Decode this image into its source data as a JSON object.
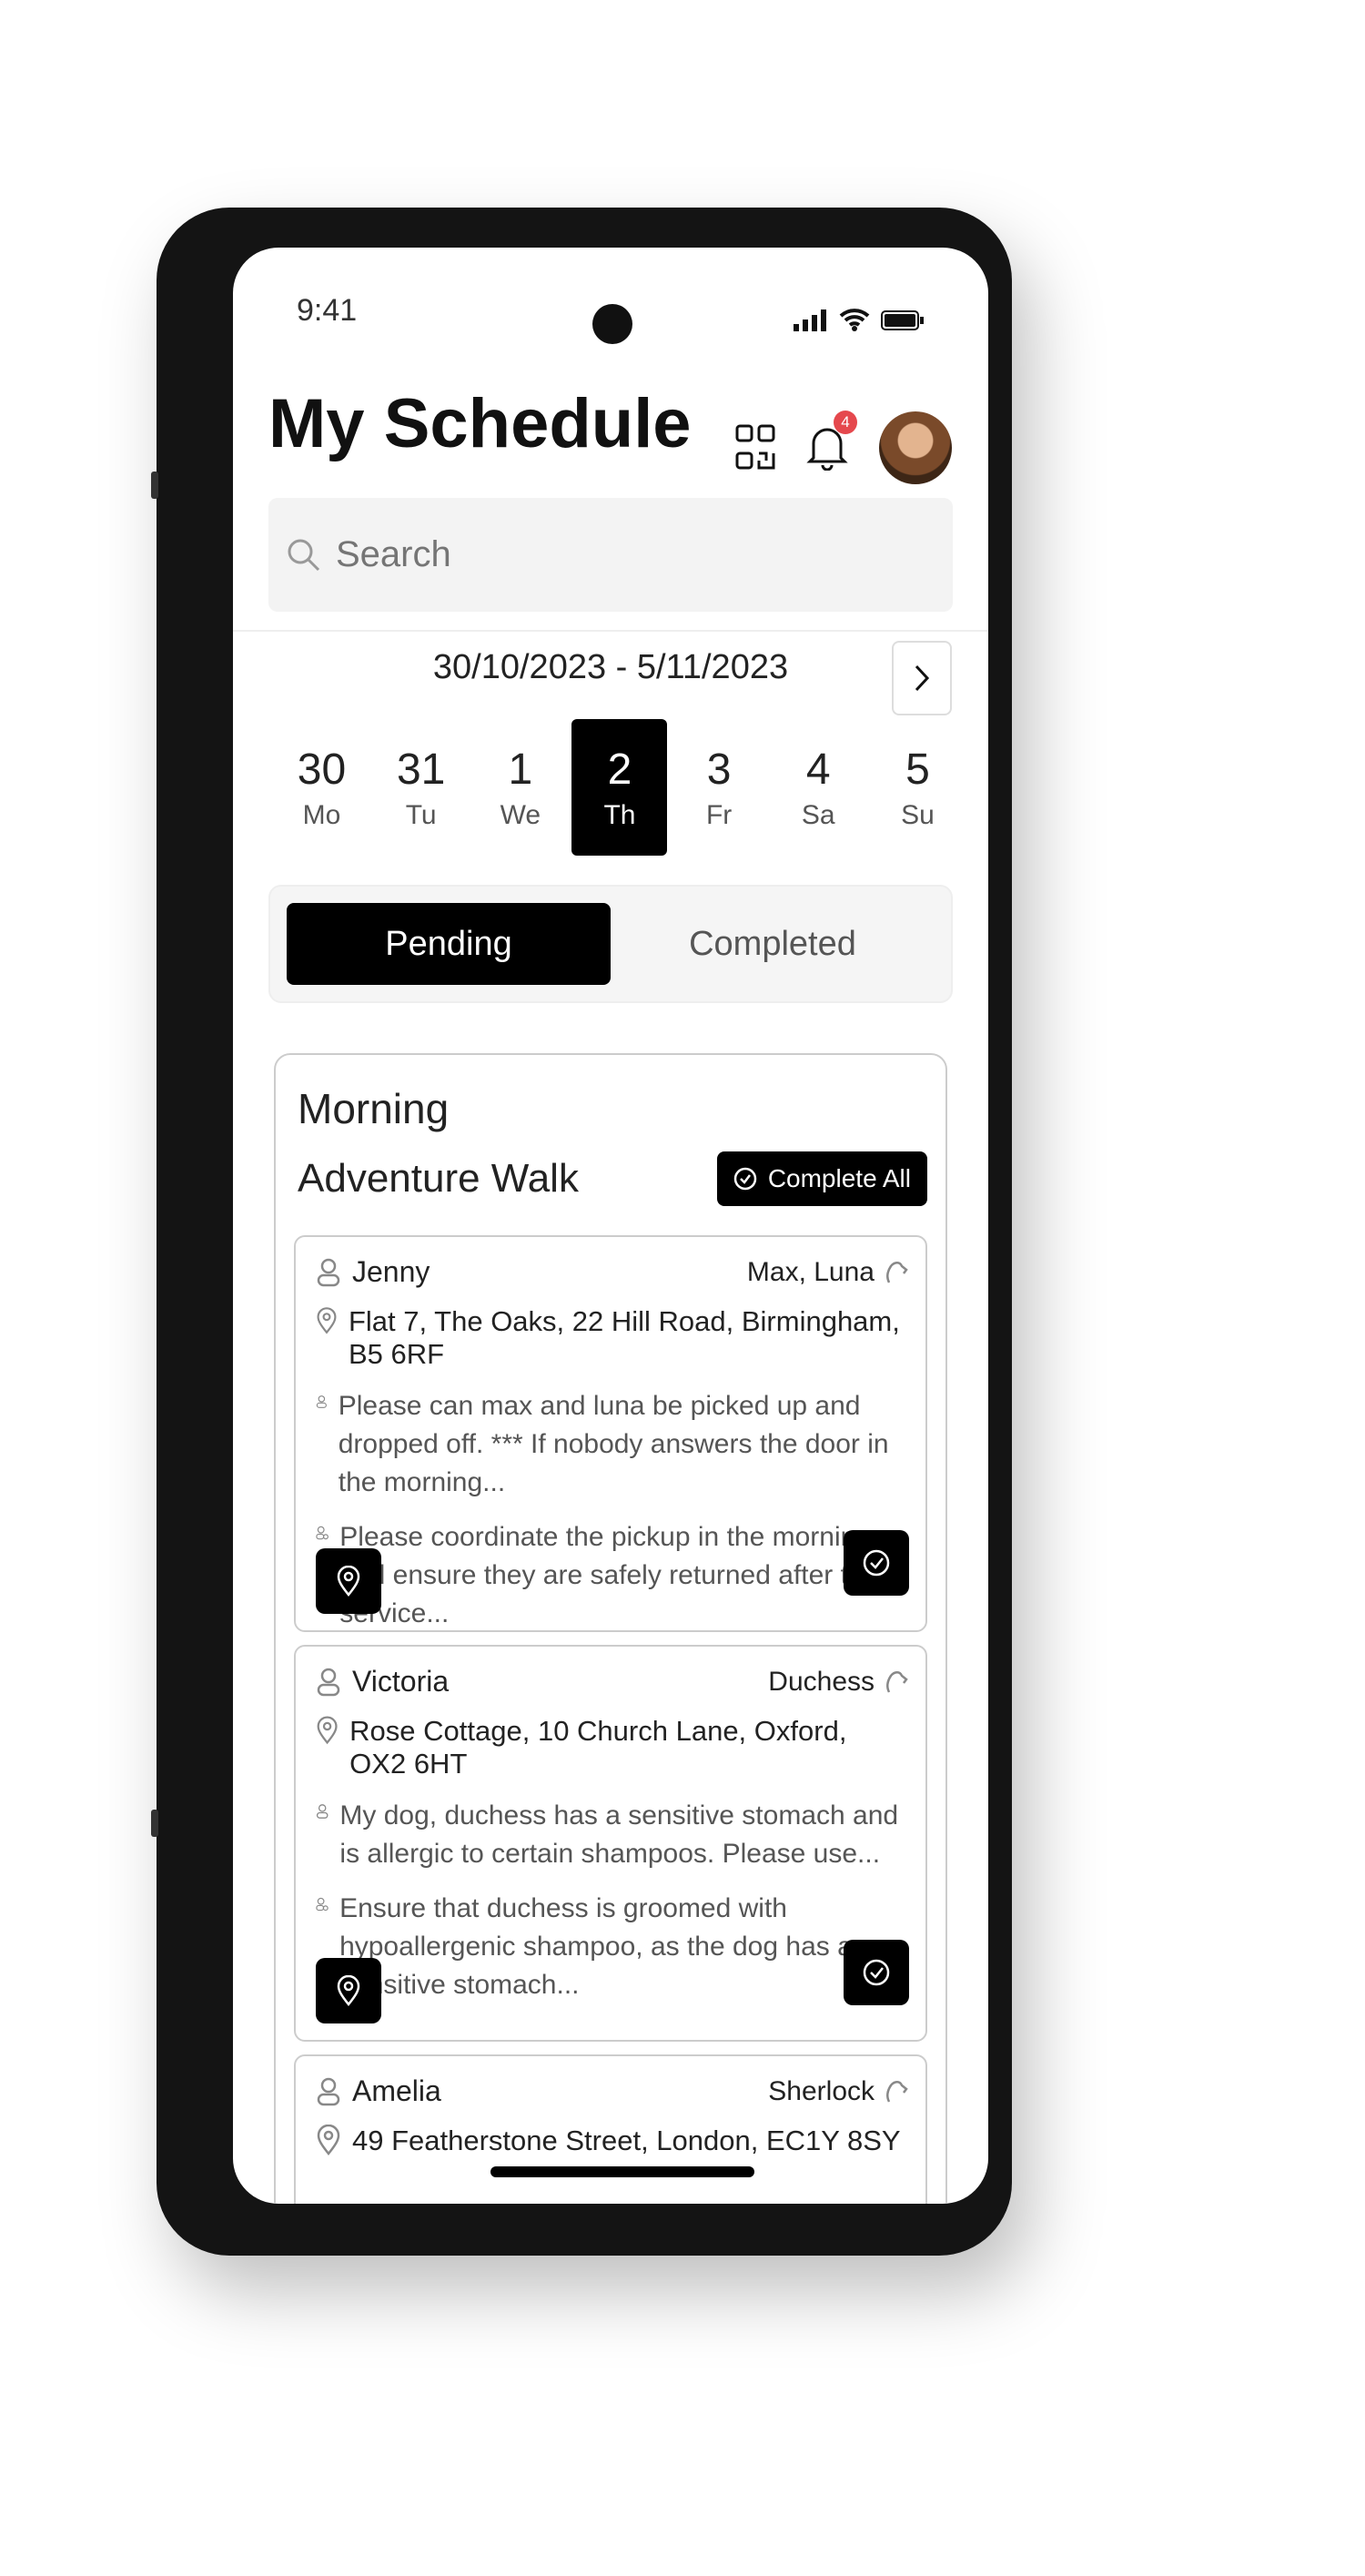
{
  "status_bar": {
    "time": "9:41"
  },
  "header": {
    "title": "My Schedule",
    "notification_count": "4",
    "search_placeholder": "Search"
  },
  "week": {
    "range": "30/10/2023 - 5/11/2023",
    "days": [
      {
        "num": "30",
        "wd": "Mo"
      },
      {
        "num": "31",
        "wd": "Tu"
      },
      {
        "num": "1",
        "wd": "We"
      },
      {
        "num": "2",
        "wd": "Th",
        "selected": true
      },
      {
        "num": "3",
        "wd": "Fr"
      },
      {
        "num": "4",
        "wd": "Sa"
      },
      {
        "num": "5",
        "wd": "Su"
      }
    ]
  },
  "tabs": {
    "pending": "Pending",
    "completed": "Completed",
    "active": "Pending"
  },
  "section": {
    "period": "Morning",
    "service": "Adventure Walk",
    "complete_all": "Complete All",
    "jobs": [
      {
        "client": "Jenny",
        "pets": "Max, Luna",
        "address": "Flat 7, The Oaks, 22 Hill Road, Birmingham, B5 6RF",
        "client_note": "Please can max and luna be picked up and dropped off. *** If nobody answers the door in the morning...",
        "staff_note": "Please coordinate the pickup in the morning and ensure they are safely returned after the service..."
      },
      {
        "client": "Victoria",
        "pets": "Duchess",
        "address": "Rose Cottage, 10 Church Lane, Oxford, OX2 6HT",
        "client_note": "My dog, duchess has a sensitive stomach and is allergic to certain shampoos. Please use...",
        "staff_note": "Ensure that duchess is groomed with hypoallergenic shampoo, as the dog has a sensitive stomach..."
      },
      {
        "client": "Amelia",
        "pets": "Sherlock",
        "address": "49 Featherstone Street, London, EC1Y 8SY",
        "client_note": "",
        "staff_note": ""
      }
    ]
  },
  "colors": {
    "accent": "#000000",
    "badge": "#e5484d"
  }
}
